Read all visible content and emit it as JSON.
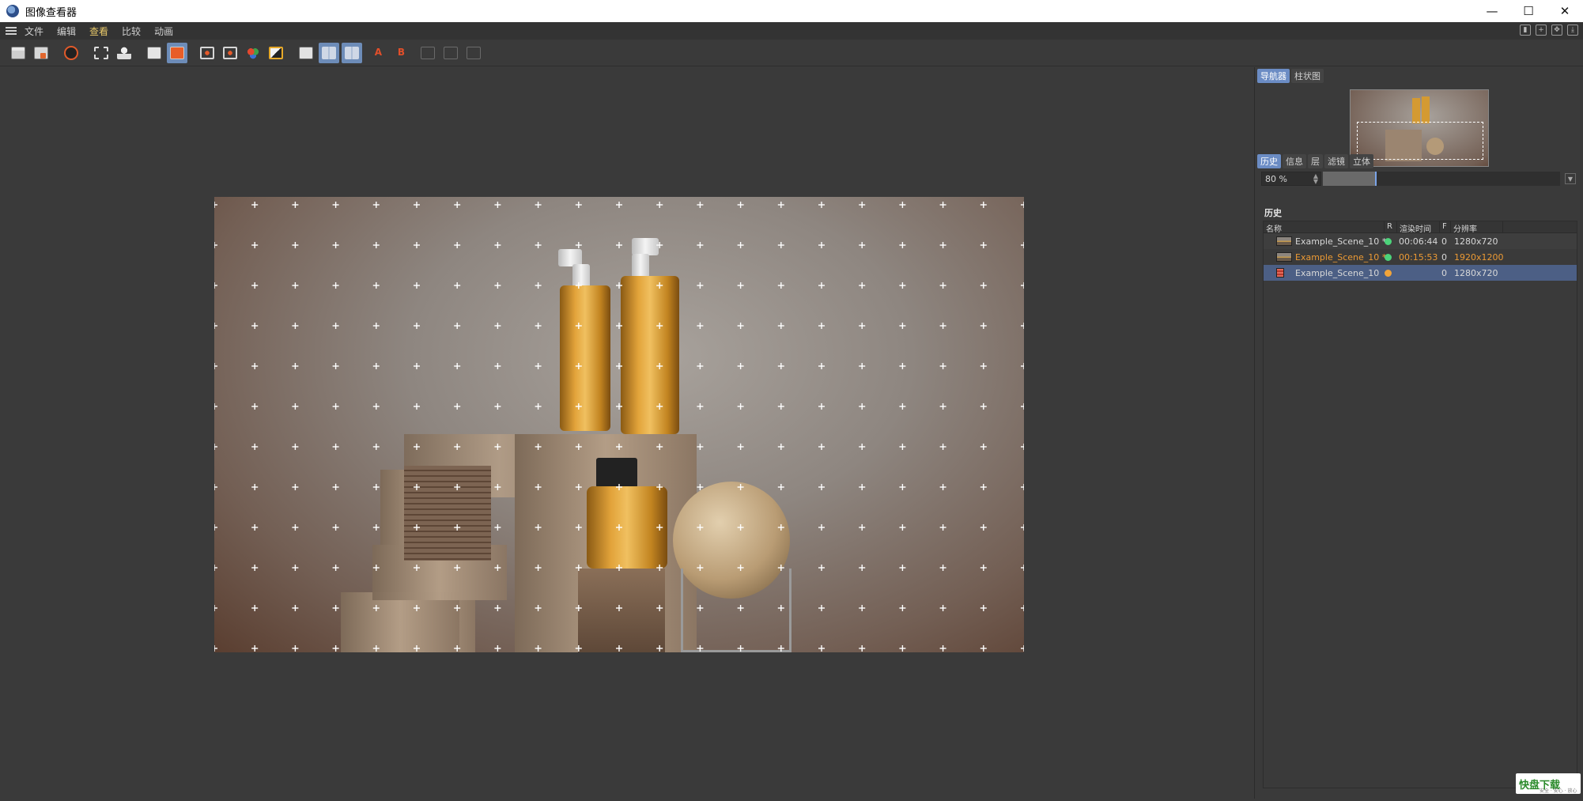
{
  "window": {
    "title": "图像查看器",
    "minimize": "—",
    "maximize": "☐",
    "close": "✕"
  },
  "menu": {
    "items": [
      "文件",
      "编辑",
      "查看",
      "比较",
      "动画"
    ],
    "active": "查看"
  },
  "toolbar": {
    "icons": [
      "open-file-icon",
      "save-icon",
      "render-icon",
      "crop-region-icon",
      "person-icon",
      "copy-doc-icon",
      "doc-orange-icon",
      "eye-view-icon",
      "eye-view-2-icon",
      "rgb-channels-icon",
      "contrast-icon",
      "ab-compare-icon",
      "split-view-icon",
      "split-view-2-icon",
      "set-a-icon",
      "set-b-icon",
      "disabled-1-icon",
      "disabled-2-icon",
      "disabled-3-icon"
    ],
    "letter_a": "A",
    "letter_b": "B"
  },
  "navigator": {
    "tabs": [
      "导航器",
      "柱状图"
    ],
    "active_tab": "导航器",
    "zoom": "80 %",
    "zoom_fraction": 0.22
  },
  "history_panel": {
    "tabs": [
      "历史",
      "信息",
      "层",
      "滤镜",
      "立体"
    ],
    "active_tab": "历史",
    "title": "历史",
    "columns": [
      "名称",
      "R",
      "渲染时间",
      "F",
      "分辨率"
    ],
    "rows": [
      {
        "name": "Example_Scene_10 *",
        "status_color": "#4cd37a",
        "time": "00:06:44",
        "frame": "0",
        "resolution": "1280x720",
        "highlight": false,
        "selected": false
      },
      {
        "name": "Example_Scene_10 *",
        "status_color": "#4cd37a",
        "time": "00:15:53",
        "frame": "0",
        "resolution": "1920x1200",
        "highlight": true,
        "selected": false
      },
      {
        "name": "Example_Scene_10",
        "status_color": "#f1a43a",
        "time": "",
        "frame": "0",
        "resolution": "1280x720",
        "highlight": false,
        "selected": true
      }
    ]
  },
  "watermark": {
    "text": "快盘下载",
    "sub": "安全 · 安心 · 放心"
  },
  "colors": {
    "accent": "#6b8cc4",
    "menu_active": "#e9c96a",
    "highlight_text": "#ec9a34"
  }
}
